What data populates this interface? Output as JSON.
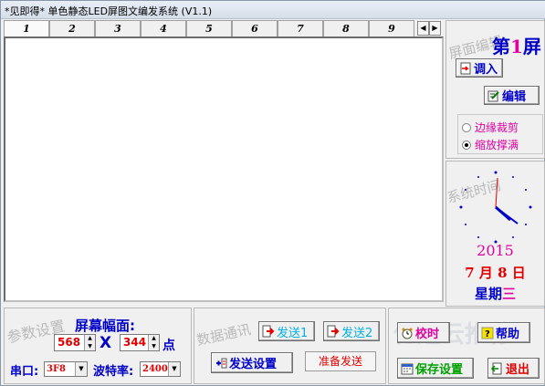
{
  "window": {
    "title": "*见即得* 单色静态LED屏图文编发系统 (V1.1)"
  },
  "tabs": [
    "1",
    "2",
    "3",
    "4",
    "5",
    "6",
    "7",
    "8",
    "9"
  ],
  "screen_panel": {
    "section_label": "屏面编辑",
    "screen_prefix": "第",
    "screen_number": "1",
    "screen_suffix": "屏",
    "load_label": "调入",
    "edit_label": "编辑",
    "options": [
      {
        "label": "边缘裁剪",
        "selected": false
      },
      {
        "label": "缩放撑满",
        "selected": true
      }
    ]
  },
  "time_panel": {
    "section_label": "系统时间",
    "year": "2015",
    "month": "7",
    "month_unit": "月",
    "day": "8",
    "day_unit": "日",
    "weekday_prefix": "星期",
    "weekday": "三"
  },
  "params": {
    "section_label": "参数设置",
    "title": "屏幕幅面:",
    "width": "568",
    "times_sign": "X",
    "height": "344",
    "unit": "点",
    "port_label": "串口:",
    "port_value": "3F8",
    "baud_label": "波特率:",
    "baud_value": "2400"
  },
  "comm": {
    "section_label": "数据通讯",
    "send1_label": "发送1",
    "send2_label": "发送2",
    "send_setup_label": "发送设置",
    "status_text": "准备发送"
  },
  "misc": {
    "calibrate_label": "校时",
    "help_label": "帮助",
    "save_setup_label": "保存设置",
    "exit_label": "退出",
    "watermark_text": "亿速云推荐"
  },
  "colors": {
    "blue": "#0000c8",
    "magenta": "#e000a0",
    "red": "#e00000",
    "cyan": "#00b0e0",
    "green": "#00a000"
  }
}
